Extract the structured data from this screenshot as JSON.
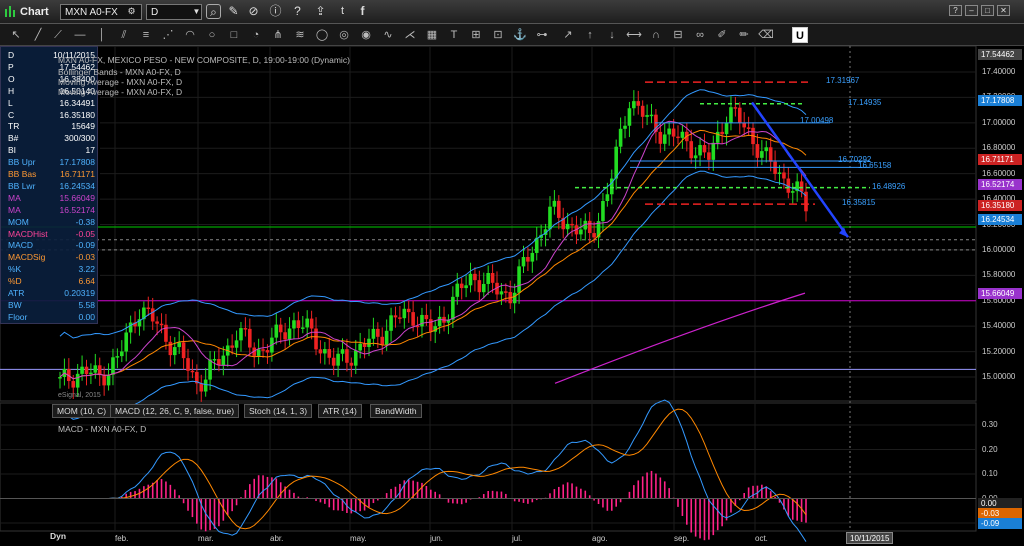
{
  "window": {
    "title": "Chart",
    "symbol": "MXN A0-FX",
    "interval": "D"
  },
  "win_controls": [
    "?",
    "–",
    "□",
    "✕"
  ],
  "legend": {
    "line1": "MXN A0-FX, MEXICO PESO - NEW COMPOSITE, D, 19:00-19:00 (Dynamic)",
    "line2": "Bollinger Bands - MXN A0-FX, D",
    "line3": "Moving Average - MXN A0-FX, D",
    "line4": "Moving Average - MXN A0-FX, D",
    "watermark": "eSignal, 2015"
  },
  "data_window": [
    {
      "k": "D",
      "v": "10/11/2015",
      "c": "#ffffff"
    },
    {
      "k": "P",
      "v": "17.54462",
      "c": "#ffffff"
    },
    {
      "k": "O",
      "v": "16.38400",
      "c": "#ffffff"
    },
    {
      "k": "H",
      "v": "16.50140",
      "c": "#ffffff"
    },
    {
      "k": "L",
      "v": "16.34491",
      "c": "#ffffff"
    },
    {
      "k": "C",
      "v": "16.35180",
      "c": "#ffffff"
    },
    {
      "k": "TR",
      "v": "15649",
      "c": "#ffffff"
    },
    {
      "k": "B#",
      "v": "300/300",
      "c": "#ffffff"
    },
    {
      "k": "BI",
      "v": "17",
      "c": "#ffffff"
    },
    {
      "k": "BB Upr",
      "v": "17.17808",
      "c": "#4fb3ff"
    },
    {
      "k": "BB Bas",
      "v": "16.71171",
      "c": "#ff9933"
    },
    {
      "k": "BB Lwr",
      "v": "16.24534",
      "c": "#4fb3ff"
    },
    {
      "k": "MA",
      "v": "15.66049",
      "c": "#cc44cc"
    },
    {
      "k": "MA",
      "v": "16.52174",
      "c": "#cc44cc"
    },
    {
      "k": "MOM",
      "v": "-0.38",
      "c": "#4fb3ff"
    },
    {
      "k": "MACDHist",
      "v": "-0.05",
      "c": "#ff4499"
    },
    {
      "k": "MACD",
      "v": "-0.09",
      "c": "#4fb3ff"
    },
    {
      "k": "MACDSig",
      "v": "-0.03",
      "c": "#ff9933"
    },
    {
      "k": "%K",
      "v": "3.22",
      "c": "#4fb3ff"
    },
    {
      "k": "%D",
      "v": "6.64",
      "c": "#ff9933"
    },
    {
      "k": "ATR",
      "v": "0.20319",
      "c": "#4fb3ff"
    },
    {
      "k": "BW",
      "v": "5.58",
      "c": "#4fb3ff"
    },
    {
      "k": "Floor",
      "v": "0.00",
      "c": "#4fb3ff"
    }
  ],
  "price_axis": [
    "17.40000",
    "17.20000",
    "17.00000",
    "16.80000",
    "16.60000",
    "16.40000",
    "16.20000",
    "16.00000",
    "15.80000",
    "15.60000",
    "15.40000",
    "15.20000",
    "15.00000"
  ],
  "price_tags": [
    {
      "v": "17.54462",
      "c": "#444444"
    },
    {
      "v": "17.17808",
      "c": "#1a7fd6"
    },
    {
      "v": "16.71171",
      "c": "#cc2222"
    },
    {
      "v": "16.52174",
      "c": "#9933cc"
    },
    {
      "v": "16.35180",
      "c": "#cc2222"
    },
    {
      "v": "16.24534",
      "c": "#1a7fd6"
    },
    {
      "v": "15.66049",
      "c": "#9933cc"
    }
  ],
  "levels": [
    "17.31967",
    "17.14935",
    "17.00498",
    "16.70292",
    "16.65158",
    "16.48926",
    "16.35815"
  ],
  "indicator_tabs": [
    "MOM (10, C)",
    "MACD (12, 26, C, 9, false, true)",
    "Stoch (14, 1, 3)",
    "ATR (14)",
    "BandWidth"
  ],
  "macd_legend": "MACD - MXN A0-FX, D",
  "macd_axis": [
    "0.30",
    "0.20",
    "0.10",
    "0.00",
    "-0.10"
  ],
  "macd_tags": [
    {
      "v": "0.00",
      "c": "#222222"
    },
    {
      "v": "-0.03",
      "c": "#dd6600"
    },
    {
      "v": "-0.09",
      "c": "#1a7fd6"
    }
  ],
  "months": [
    "feb.",
    "mar.",
    "abr.",
    "may.",
    "jun.",
    "jul.",
    "ago.",
    "sep.",
    "oct."
  ],
  "date_tag": "10/11/2015",
  "dyn_label": "Dyn",
  "chart_data": {
    "type": "candlestick",
    "symbol": "MXN A0-FX",
    "close_last": 16.3518,
    "ylim": [
      14.9,
      17.55
    ],
    "approx_closes": [
      14.95,
      15.05,
      15.0,
      15.15,
      15.55,
      15.4,
      15.2,
      14.95,
      15.1,
      15.35,
      15.2,
      15.3,
      15.45,
      15.3,
      15.1,
      15.2,
      15.3,
      15.45,
      15.5,
      15.35,
      15.6,
      15.8,
      15.7,
      15.65,
      16.0,
      16.3,
      16.2,
      16.1,
      16.5,
      17.2,
      17.0,
      16.9,
      16.85,
      16.7,
      17.1,
      16.95,
      16.7,
      16.55,
      16.35
    ]
  }
}
